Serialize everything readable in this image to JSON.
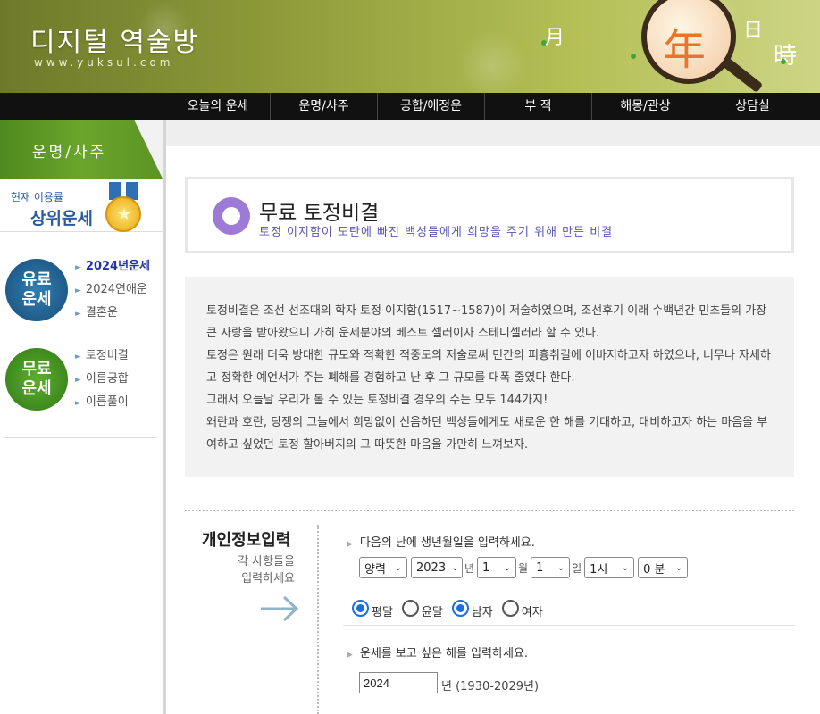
{
  "header": {
    "logo_title": "디지털 역술방",
    "logo_url": "www.yuksul.com",
    "hanja": {
      "month": "月",
      "year": "年",
      "day": "日",
      "time": "時"
    }
  },
  "nav": {
    "items": [
      "오늘의 운세",
      "운명/사주",
      "궁합/애정운",
      "부 적",
      "해몽/관상",
      "상담실"
    ]
  },
  "sidebar": {
    "section_title": "운명/사주",
    "rank_small": "현재 이용률",
    "rank_big": "상위운세",
    "paid_badge": {
      "line1": "유료",
      "line2": "운세"
    },
    "paid_menu": [
      {
        "label": "2024년운세",
        "active": true
      },
      {
        "label": "2024연애운",
        "active": false
      },
      {
        "label": "결혼운",
        "active": false
      }
    ],
    "free_badge": {
      "line1": "무료",
      "line2": "운세"
    },
    "free_menu": [
      {
        "label": "토정비결"
      },
      {
        "label": "이름궁합"
      },
      {
        "label": "이름풀이"
      }
    ]
  },
  "main": {
    "title": "무료 토정비결",
    "subtitle": "토정 이지함이 도탄에 빠진 백성들에게 희망을 주기 위해 만든 비결",
    "description": [
      "토정비결은 조선 선조때의 학자 토정 이지함(1517~1587)이 저술하였으며, 조선후기 이래 수백년간 민초들의 가장 큰 사랑을 받아왔으니 가히 운세분야의 베스트 셀러이자 스테디셀러라 할 수 있다.",
      "토정은 원래 더욱 방대한 규모와 적확한 적중도의 저술로써 민간의 피흉취길에 이바지하고자 하였으나, 너무나 자세하고 정확한 예언서가 주는 폐해를 경험하고 난 후 그 규모를 대폭 줄였다 한다.",
      "그래서 오늘날 우리가 볼 수 있는 토정비결 경우의 수는 모두 144가지!",
      "왜란과 호란, 당쟁의 그늘에서 희망없이 신음하던 백성들에게도 새로운 한 해를 기대하고, 대비하고자 하는 마음을 부여하고 싶었던 토정 할아버지의 그 따뜻한 마음을 가만히 느껴보자."
    ]
  },
  "form": {
    "section_title": "개인정보입력",
    "section_sub_line1": "각 사항들을",
    "section_sub_line2": "입력하세요",
    "birth_label": "다음의 난에 생년월일을 입력하세요.",
    "calendar": "양력",
    "year": "2023",
    "year_unit": "년",
    "month": "1",
    "month_unit": "월",
    "day": "1",
    "day_unit": "일",
    "hour": "1시",
    "minute": "0 분",
    "radios": {
      "normal_month": "평달",
      "leap_month": "윤달",
      "male": "남자",
      "female": "여자",
      "selected_month": "평달",
      "selected_gender": "남자"
    },
    "target_label": "운세를 보고 싶은 해를 입력하세요.",
    "target_year": "2024",
    "target_year_note": "년  (1930-2029년)"
  },
  "colors": {
    "nav_bg": "#111111",
    "accent_purple": "#9c7ad6",
    "subtitle_color": "#5a55b0",
    "active_menu": "#2233aa",
    "radio_checked": "#1a6fe0"
  }
}
